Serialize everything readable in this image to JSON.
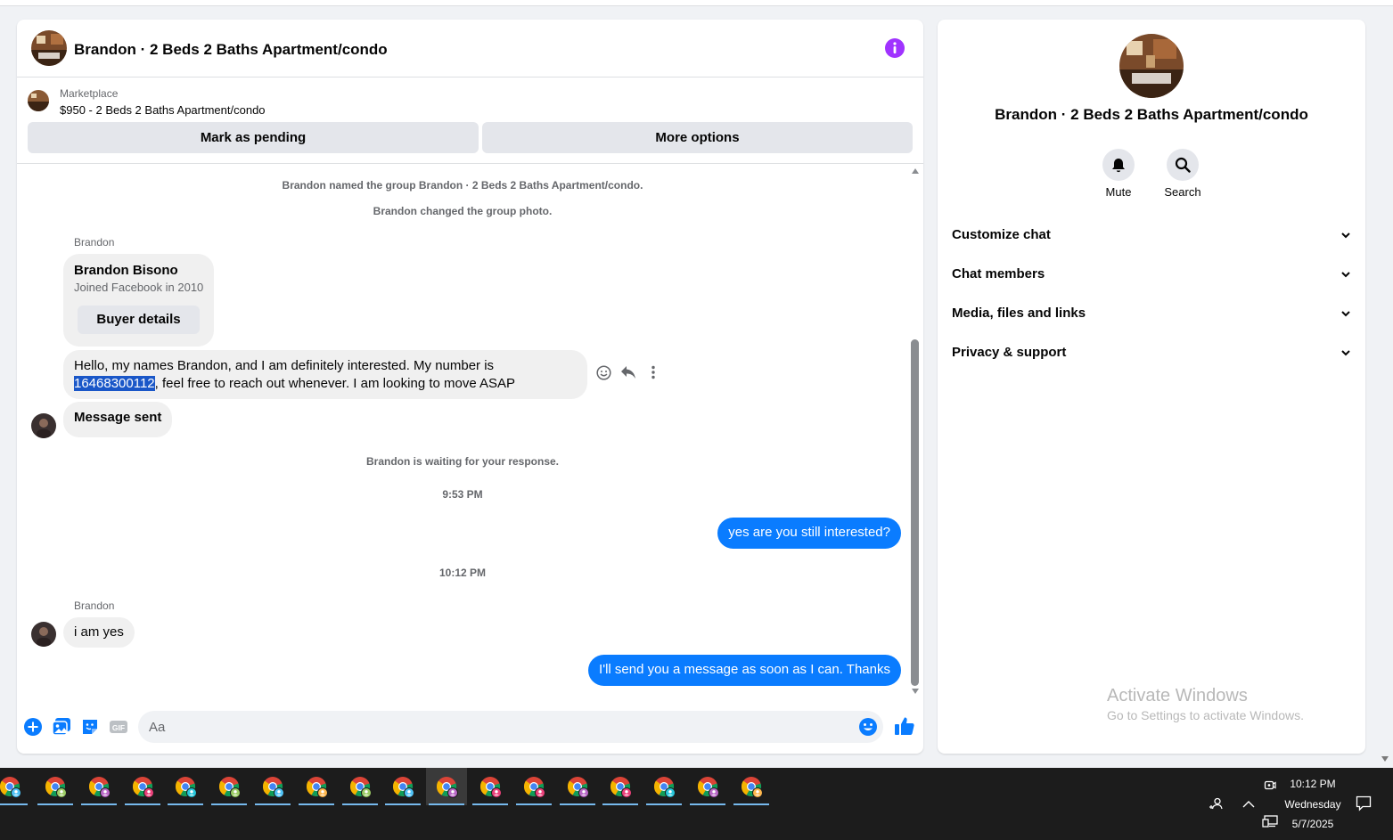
{
  "chat": {
    "title": "Brandon · 2 Beds 2 Baths Apartment/condo",
    "marketplace_label": "Marketplace",
    "listing": "$950 - 2 Beds 2 Baths Apartment/condo",
    "mark_pending_label": "Mark as pending",
    "more_options_label": "More options",
    "system_messages": {
      "named_group": "Brandon named the group Brandon · 2 Beds 2 Baths Apartment/condo.",
      "changed_photo": "Brandon changed the group photo.",
      "waiting": "Brandon is waiting for your response."
    },
    "timestamps": [
      "9:53 PM",
      "10:12 PM"
    ],
    "sender_name": "Brandon",
    "buyer_card": {
      "name": "Brandon Bisono",
      "joined": "Joined Facebook in 2010",
      "button_label": "Buyer details"
    },
    "message1": {
      "text_before": "Hello, my names Brandon, and I am definitely interested. My number is ",
      "highlighted": "16468300112",
      "text_after": ", feel free to reach out whenever. I am looking to move ASAP"
    },
    "message_sent": "Message sent",
    "outgoing_1": "yes are you still interested?",
    "incoming_2": "i am yes",
    "outgoing_2": "I'll send you a message as soon as I can. Thanks",
    "composer_placeholder": "Aa",
    "gif_label": "GIF"
  },
  "info_panel": {
    "title": "Brandon · 2 Beds 2 Baths Apartment/condo",
    "mute_label": "Mute",
    "search_label": "Search",
    "sections": [
      "Customize chat",
      "Chat members",
      "Media, files and links",
      "Privacy & support"
    ]
  },
  "watermark": {
    "title": "Activate Windows",
    "subtitle": "Go to Settings to activate Windows."
  },
  "taskbar": {
    "time": "10:12 PM",
    "day": "Wednesday",
    "date": "5/7/2025",
    "app_count": 18
  },
  "colors": {
    "accent_blue": "#0a7cff",
    "info_purple": "#a033ff",
    "selection": "#1a57c8",
    "taskbar": "#1c1c1c"
  }
}
